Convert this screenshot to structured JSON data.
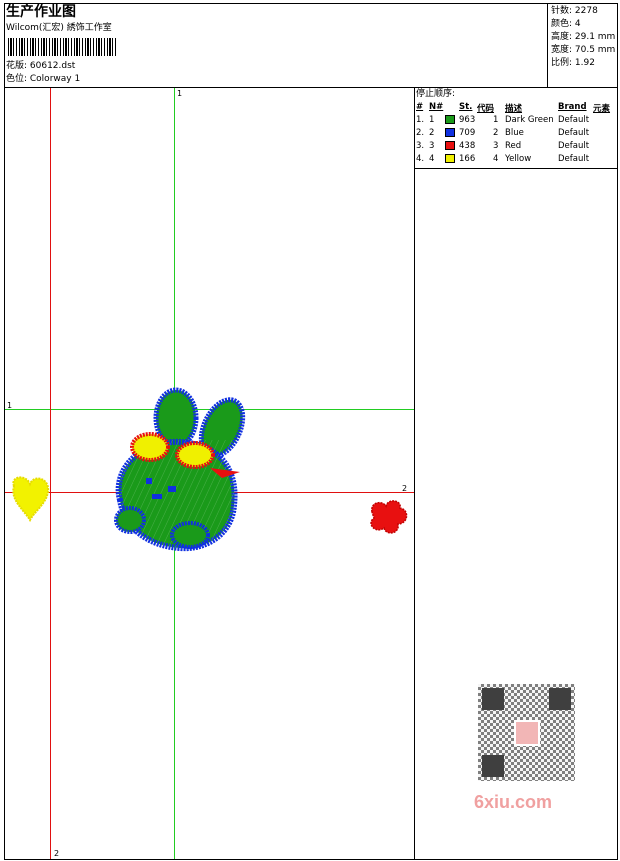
{
  "header": {
    "title": "生产作业图",
    "subtitle": "Wilcom(汇宏) 綉饰工作室",
    "design_label": "花版: 60612.dst",
    "colorway_label": "色位: Colorway 1"
  },
  "stats": {
    "stitches": "针数: 2278",
    "colors": "颜色: 4",
    "height": "高度: 29.1 mm",
    "width": "宽度: 70.5 mm",
    "scale": "比例: 1.92"
  },
  "stop_sequence": {
    "title": "停止顺序:",
    "headers": [
      "#",
      "N#",
      "St.",
      "代码",
      "描述",
      "Brand",
      "元素"
    ],
    "rows": [
      {
        "num": "1.",
        "n": "1",
        "color": "#1a9a1a",
        "st": "963",
        "code": "1",
        "desc": "Dark Green",
        "brand": "Default"
      },
      {
        "num": "2.",
        "n": "2",
        "color": "#1030e0",
        "st": "709",
        "code": "2",
        "desc": "Blue",
        "brand": "Default"
      },
      {
        "num": "3.",
        "n": "3",
        "color": "#e81010",
        "st": "438",
        "code": "3",
        "desc": "Red",
        "brand": "Default"
      },
      {
        "num": "4.",
        "n": "4",
        "color": "#f0f000",
        "st": "166",
        "code": "4",
        "desc": "Yellow",
        "brand": "Default"
      }
    ]
  },
  "crosshairs": {
    "v1_top": "1",
    "h1_left": "1",
    "h2_right": "2",
    "v2_bottom": "2"
  },
  "watermark": {
    "text": "6xiu.com"
  }
}
